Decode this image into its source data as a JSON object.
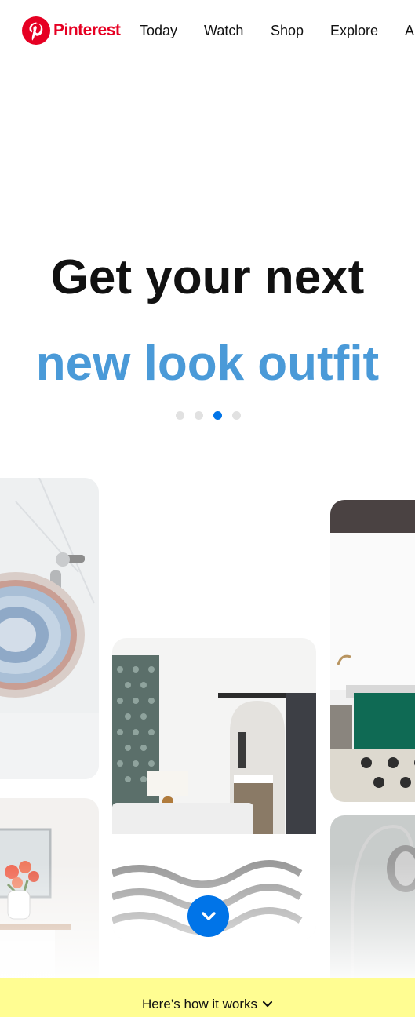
{
  "brand": {
    "name": "Pinterest",
    "color": "#e60023",
    "logo_icon": "pinterest-p-icon"
  },
  "nav": {
    "items": [
      {
        "label": "Today"
      },
      {
        "label": "Watch"
      },
      {
        "label": "Shop"
      },
      {
        "label": "Explore"
      },
      {
        "label": "A"
      }
    ]
  },
  "hero": {
    "line1": "Get your next",
    "line2": "new look outfit",
    "line2_color": "#4a9ad8",
    "carousel": {
      "dot_count": 4,
      "active_index": 2,
      "active_color": "#0074e8"
    }
  },
  "gallery": {
    "cards": [
      {
        "subject": "ornate blue patterned sink basin"
      },
      {
        "subject": "pink flowers in vase"
      },
      {
        "subject": "bedroom with arched doorway and striped bedding"
      },
      {
        "subject": "bathroom with green tub and patterned tile floor"
      },
      {
        "subject": "arc floor lamp"
      }
    ]
  },
  "scroll_button": {
    "icon": "chevron-down-icon",
    "color": "#0074e8"
  },
  "footer": {
    "text": "Here’s how it works",
    "icon": "chevron-down-icon",
    "background": "#fffd92"
  }
}
